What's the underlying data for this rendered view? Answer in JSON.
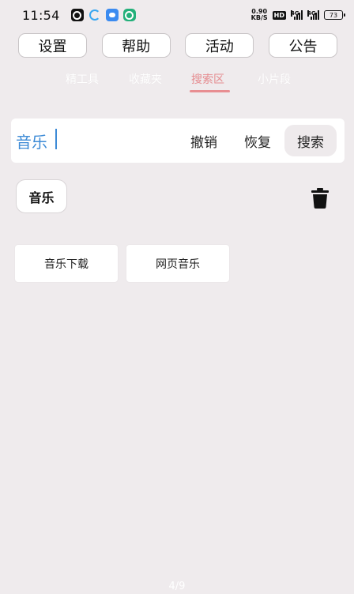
{
  "status_bar": {
    "time": "11:54",
    "net_speed_value": "0.90",
    "net_speed_unit": "KB/S",
    "hd_badge": "HD",
    "signal1_label": "4G",
    "signal2_label": "4G",
    "battery": "73",
    "app_icons": [
      "k-app-icon",
      "o-app-icon",
      "b-app-icon",
      "g-app-icon"
    ]
  },
  "top_buttons": [
    "设置",
    "帮助",
    "活动",
    "公告"
  ],
  "tabs": [
    {
      "label": "精工具",
      "active": false
    },
    {
      "label": "收藏夹",
      "active": false
    },
    {
      "label": "搜索区",
      "active": true
    },
    {
      "label": "小片段",
      "active": false
    }
  ],
  "search_bar": {
    "value": "音乐",
    "undo_label": "撤销",
    "redo_label": "恢复",
    "search_label": "搜索"
  },
  "history_chip": "音乐",
  "options": [
    "音乐下载",
    "网页音乐"
  ],
  "pager": "4/9",
  "colors": {
    "background": "#efebed",
    "accent": "#e88e92",
    "input_text": "#3d8bd6"
  }
}
